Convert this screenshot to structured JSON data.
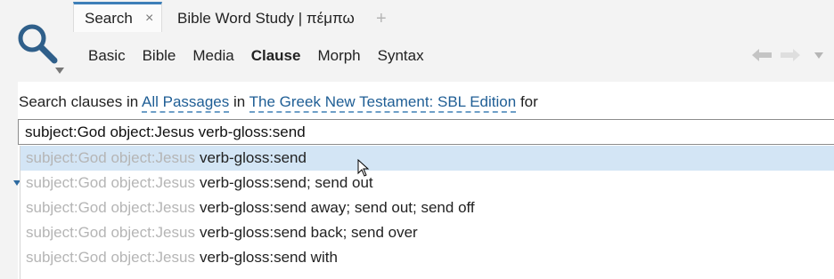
{
  "tabs": [
    {
      "label": "Search",
      "active": true
    },
    {
      "label": "Bible Word Study | πέμπω",
      "active": false
    }
  ],
  "tab_close_glyph": "×",
  "tab_add_glyph": "+",
  "subnav": {
    "items": [
      "Basic",
      "Bible",
      "Media",
      "Clause",
      "Morph",
      "Syntax"
    ],
    "active": "Clause"
  },
  "nav": {
    "back_glyph": "🡐",
    "forward_glyph": "🡒"
  },
  "prompt": {
    "prefix": "Search clauses in",
    "scope": "All Passages",
    "middle": "in",
    "resource": "The Greek New Testament: SBL Edition",
    "suffix": "for"
  },
  "query": {
    "value": "subject:God object:Jesus verb-gloss:send"
  },
  "suggestions": {
    "prefix": "subject:God object:Jesus",
    "items": [
      {
        "suffix": "verb-gloss:send",
        "selected": true
      },
      {
        "suffix": "verb-gloss:send; send out",
        "selected": false
      },
      {
        "suffix": "verb-gloss:send away; send out; send off",
        "selected": false
      },
      {
        "suffix": "verb-gloss:send back; send over",
        "selected": false
      },
      {
        "suffix": "verb-gloss:send with",
        "selected": false
      }
    ]
  },
  "colors": {
    "accent": "#3d7fb8",
    "link": "#1f5e95",
    "selection": "#d3e5f5"
  },
  "icons": [
    "search-icon",
    "dropdown-arrow-icon",
    "back-arrow-icon",
    "forward-arrow-icon",
    "mouse-cursor-icon"
  ]
}
